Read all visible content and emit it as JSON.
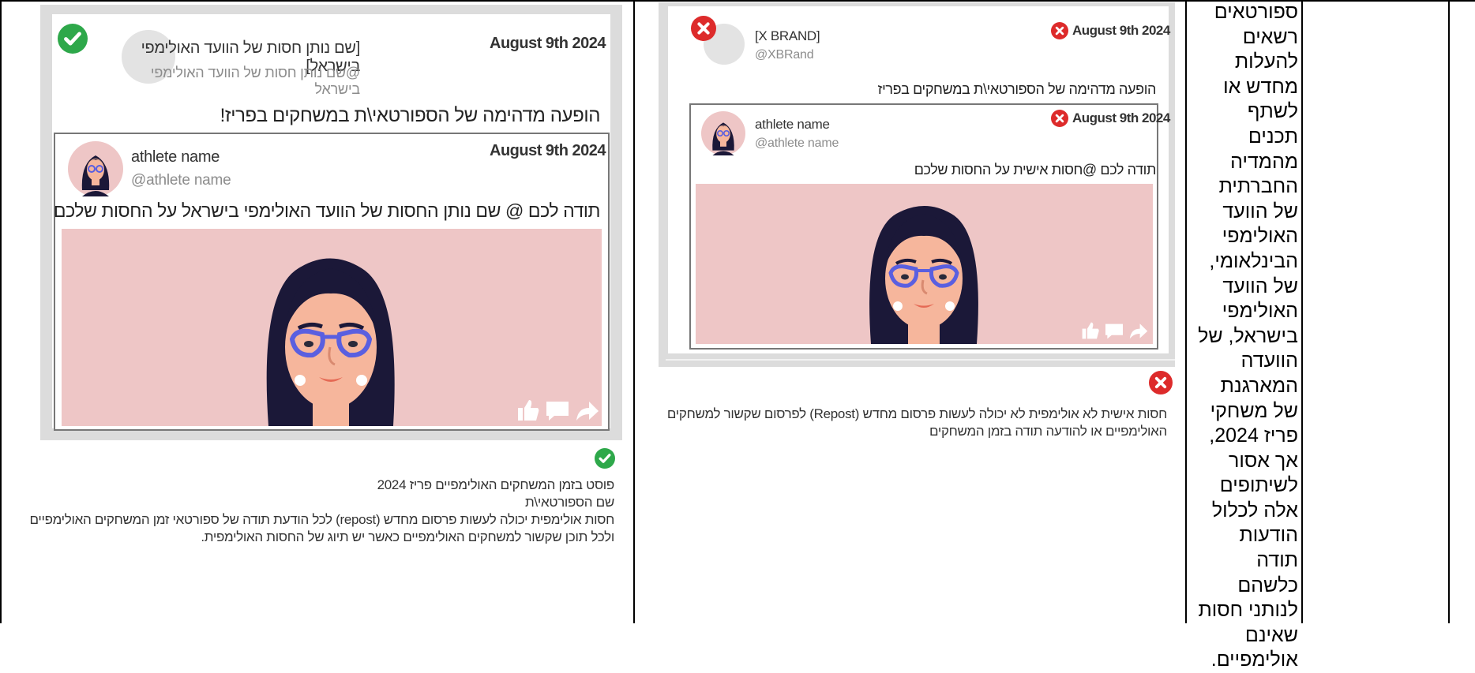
{
  "left_example": {
    "post": {
      "name": "[שם נותן חסות של הוועד האולימפי בישראל]",
      "handle": "@שם נותן חסות של הוועד האולימפי בישראל",
      "date": "August 9th 2024",
      "text": "הופעה מדהימה של הספורטאי\\ת במשחקים בפריז!"
    },
    "quoted": {
      "name": "athlete name",
      "handle": "@athlete name",
      "date": "August 9th 2024",
      "text": "תודה לכם @ שם נותן החסות של הוועד האולימפי בישראל על החסות שלכם"
    },
    "status": "allowed",
    "caption": [
      "פוסט בזמן המשחקים האולימפיים פריז 2024",
      "שם הספורטאי\\ת",
      "חסות אולימפית יכולה לעשות פרסום מחדש (repost) לכל הודעת תודה של ספורטאי זמן המשחקים האולימפיים",
      "ולכל תוכן שקשור למשחקים האולימפיים כאשר יש תיוג של החסות האולימפית."
    ]
  },
  "right_example": {
    "post": {
      "name": "[X BRAND]",
      "handle": "@XBRand",
      "date": "August 9th 2024",
      "text": "הופעה מדהימה של הספורטאי\\ת במשחקים בפריז"
    },
    "quoted": {
      "name": "athlete name",
      "handle": "@athlete name",
      "date": "August 9th 2024",
      "text": "תודה לכם @חסות אישית על החסות שלכם"
    },
    "status": "not-allowed",
    "caption": [
      "חסות אישית לא אולימפית לא יכולה לעשות פרסום מחדש (Repost) לפרסום שקשור למשחקים",
      "האולימפיים או להודעה תודה בזמן המשחקים"
    ]
  },
  "rule_text": "ספורטאים רשאים להעלות מחדש או לשתף תכנים מהמדיה החברתית של הוועד האולימפי הבינלאומי, של הוועד האולימפי בישראל, של הוועדה המארגנת של משחקי פריז 2024, אך אסור לשיתופים אלה לכלול הודעות תודה כלשהם לנותני חסות שאינם אולימפיים.",
  "colors": {
    "allowed": "#2ea84a",
    "not_allowed": "#dd2b2b",
    "pink_bg": "#eec6c6",
    "hair": "#1b1838",
    "glasses": "#5a5fe0",
    "skin": "#f6b69c"
  },
  "icons": [
    "check-circle-icon",
    "x-circle-icon",
    "like-icon",
    "comment-icon",
    "share-icon"
  ]
}
